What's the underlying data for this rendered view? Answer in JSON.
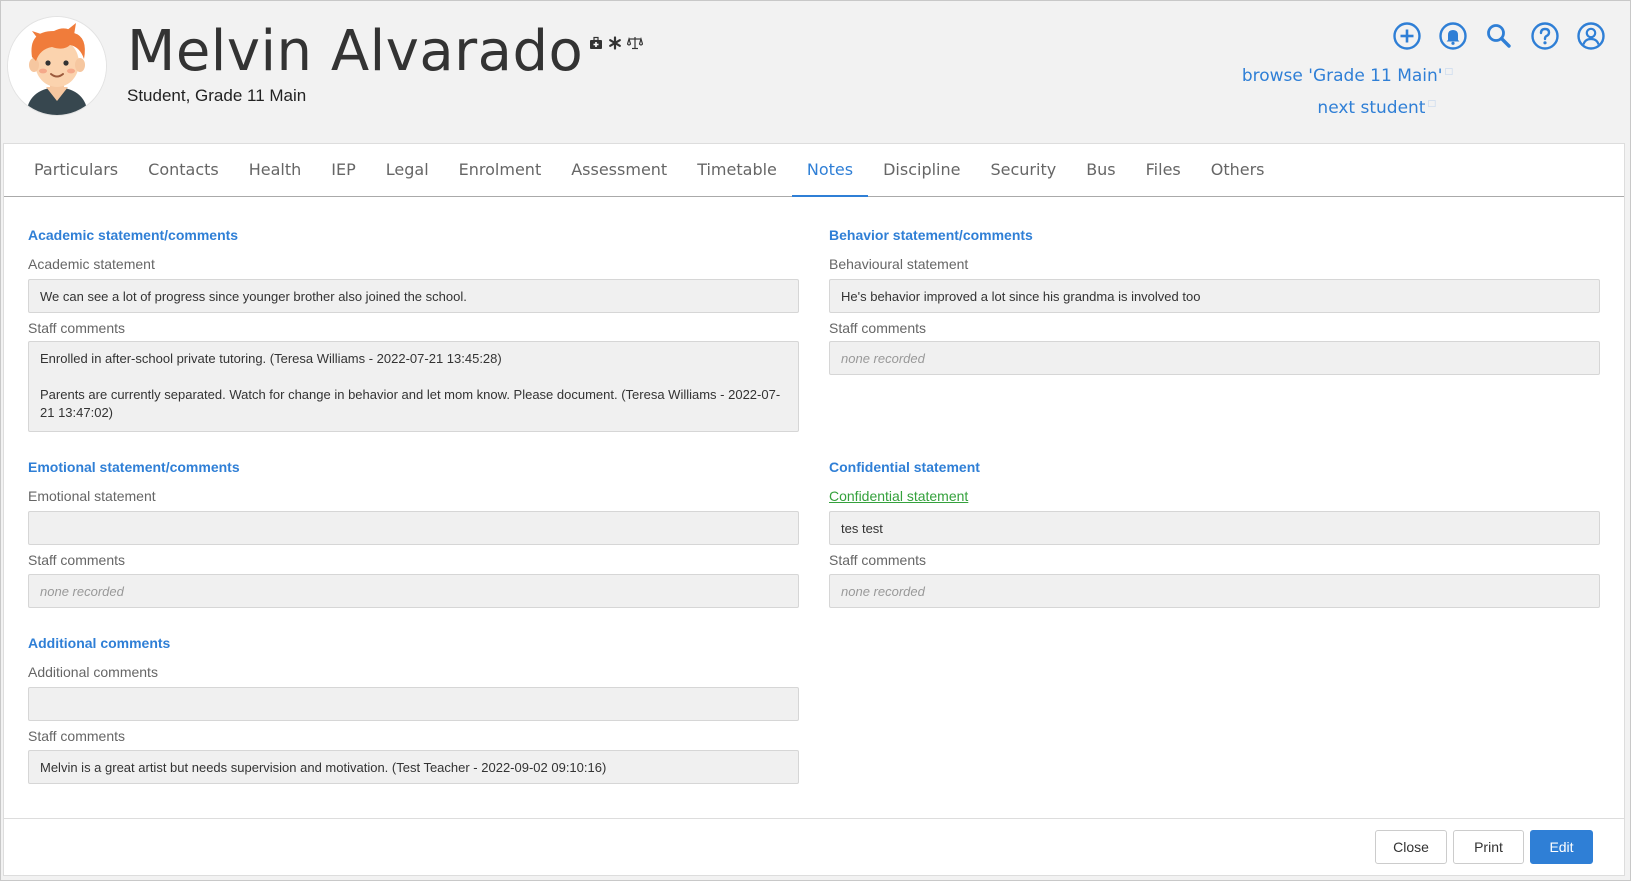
{
  "student": {
    "name": "Melvin Alvarado",
    "subtitle": "Student, Grade 11 Main",
    "badges": [
      "medical-kit-icon",
      "asterisk-icon",
      "scales-icon"
    ]
  },
  "nav": {
    "browse_label": "browse 'Grade 11 Main'",
    "next_label": "next student",
    "icons": [
      "add-circle-icon",
      "bell-icon",
      "search-icon",
      "help-icon",
      "account-icon"
    ]
  },
  "tabs": [
    {
      "label": "Particulars",
      "active": false
    },
    {
      "label": "Contacts",
      "active": false
    },
    {
      "label": "Health",
      "active": false
    },
    {
      "label": "IEP",
      "active": false
    },
    {
      "label": "Legal",
      "active": false
    },
    {
      "label": "Enrolment",
      "active": false
    },
    {
      "label": "Assessment",
      "active": false
    },
    {
      "label": "Timetable",
      "active": false
    },
    {
      "label": "Notes",
      "active": true
    },
    {
      "label": "Discipline",
      "active": false
    },
    {
      "label": "Security",
      "active": false
    },
    {
      "label": "Bus",
      "active": false
    },
    {
      "label": "Files",
      "active": false
    },
    {
      "label": "Others",
      "active": false
    }
  ],
  "sections": {
    "academic": {
      "title": "Academic statement/comments",
      "statement_label": "Academic statement",
      "statement": "We can see a lot of progress since younger brother also joined the school.",
      "staff_label": "Staff comments",
      "staff_comments": [
        "Enrolled in after-school private tutoring. (Teresa Williams - 2022-07-21 13:45:28)",
        "Parents are currently separated. Watch for change in behavior and let mom know. Please document. (Teresa Williams - 2022-07-21 13:47:02)"
      ]
    },
    "behavior": {
      "title": "Behavior statement/comments",
      "statement_label": "Behavioural statement",
      "statement": "He's behavior improved a lot since his grandma is involved too",
      "staff_label": "Staff comments",
      "staff_comments": "none recorded"
    },
    "emotional": {
      "title": "Emotional statement/comments",
      "statement_label": "Emotional statement",
      "statement": "",
      "staff_label": "Staff comments",
      "staff_comments": "none recorded"
    },
    "confidential": {
      "title": "Confidential statement",
      "statement_label": "Confidential statement",
      "statement": "tes test",
      "staff_label": "Staff comments",
      "staff_comments": "none recorded"
    },
    "additional": {
      "title": "Additional comments",
      "statement_label": "Additional comments",
      "statement": "",
      "staff_label": "Staff comments",
      "staff_comments": "Melvin is a great artist but needs supervision and motivation. (Test Teacher - 2022-09-02 09:10:16)"
    }
  },
  "footer": {
    "close_label": "Close",
    "print_label": "Print",
    "edit_label": "Edit"
  },
  "colors": {
    "accent": "#2f7fd6",
    "link_green": "#34a13c"
  }
}
